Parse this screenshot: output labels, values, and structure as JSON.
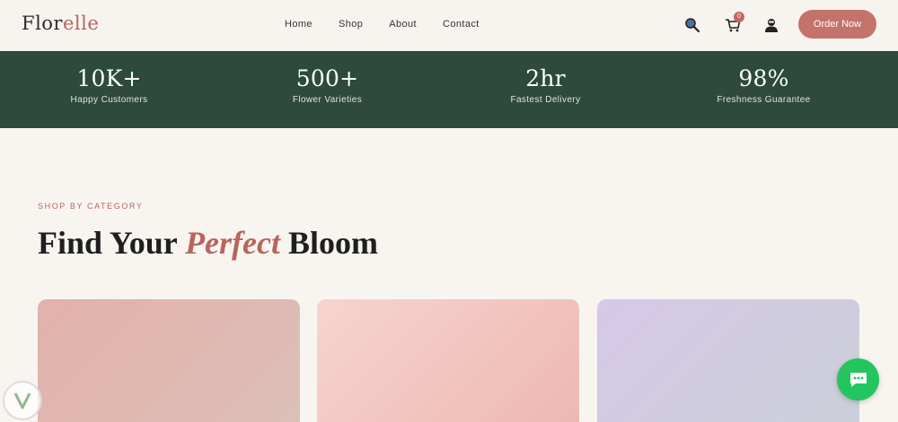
{
  "header": {
    "logo_main": "Flor",
    "logo_accent": "elle",
    "nav": [
      "Home",
      "Shop",
      "About",
      "Contact"
    ],
    "cart_count": "0",
    "order_label": "Order Now"
  },
  "stats": [
    {
      "value": "10K+",
      "label": "Happy Customers"
    },
    {
      "value": "500+",
      "label": "Flower Varieties"
    },
    {
      "value": "2hr",
      "label": "Fastest Delivery"
    },
    {
      "value": "98%",
      "label": "Freshness Guarantee"
    }
  ],
  "category": {
    "eyebrow": "SHOP BY CATEGORY",
    "heading_start": "Find Your ",
    "heading_em": "Perfect",
    "heading_end": " Bloom"
  },
  "colors": {
    "accent": "#c4736a",
    "stats_bg": "#2d4a3c",
    "chat": "#22c55e"
  },
  "icons": [
    "search-icon",
    "cart-icon",
    "user-icon",
    "chat-icon",
    "watermark-logo-icon"
  ]
}
